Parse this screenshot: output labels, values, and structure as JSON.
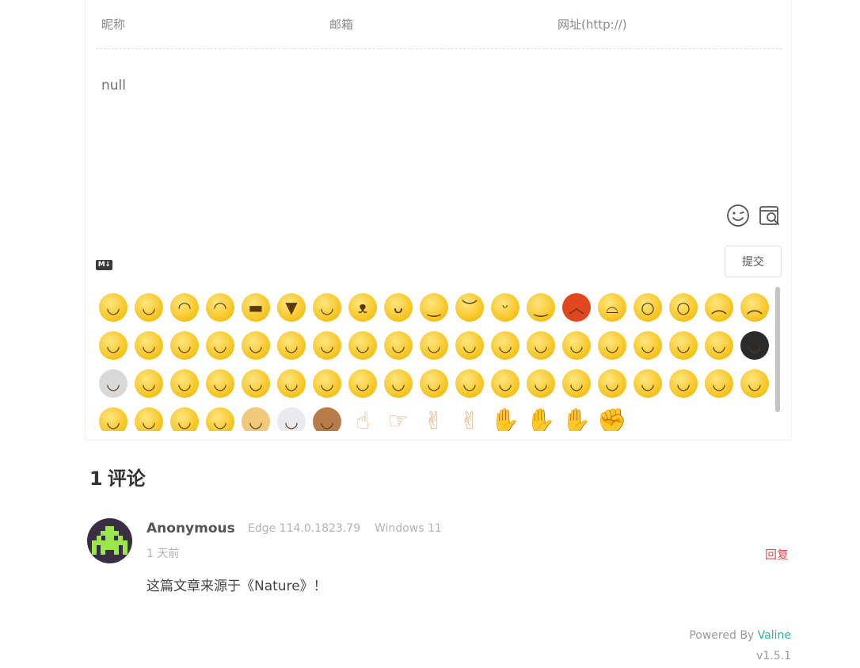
{
  "form": {
    "nick_placeholder": "昵称",
    "mail_placeholder": "邮箱",
    "link_placeholder": "网址(http://)",
    "editor_value": "null",
    "markdown_badge": "M↓",
    "submit_label": "提交"
  },
  "emoji_panel": {
    "rows": [
      [
        "smile",
        "blush",
        "shy",
        "cover-mouth",
        "grin",
        "laugh",
        "tears-joy",
        "tongue",
        "lick",
        "unamused",
        "sweat",
        "shh",
        "star-face",
        "angry",
        "worried",
        "scared",
        "shocked",
        "pleading",
        "crying"
      ],
      [
        "rofl",
        "blissful",
        "facepalm",
        "kiss-heart",
        "wink-smile",
        "heart-eyes",
        "wow",
        "heart-tongue",
        "cheesy",
        "smirk",
        "relieved",
        "thinking",
        "cool",
        "nerd",
        "dizzy-eyes",
        "question",
        "sleepy",
        "spiral",
        "tear-dark"
      ],
      [
        "skull",
        "hmm",
        "zip-mouth",
        "sad-surprised",
        "confused",
        "vomit",
        "mask",
        "sick",
        "clap",
        "cheer",
        "eye-roll",
        "tilt",
        "tilt-right",
        "sob",
        "rage",
        "puzzled",
        "hammer",
        "bang",
        "money"
      ],
      [
        "yawn",
        "squint",
        "drowsy",
        "hug",
        "dog",
        "panda",
        "cat",
        "thumbs-up",
        "point-right",
        "yeah",
        "peace",
        "shake",
        "ok-hand",
        "wave",
        "fist"
      ]
    ]
  },
  "comments": {
    "count": "1",
    "count_label": "评论",
    "items": [
      {
        "author": "Anonymous",
        "browser": "Edge 114.0.1823.79",
        "os": "Windows 11",
        "time": "1 天前",
        "reply_label": "回复",
        "content": "这篇文章来源于《Nature》！"
      }
    ]
  },
  "footer": {
    "powered_prefix": "Powered By ",
    "powered_brand": "Valine",
    "version": "v1.5.1"
  },
  "colors": {
    "accent": "#1abc9c",
    "reply": "#d9534f"
  }
}
